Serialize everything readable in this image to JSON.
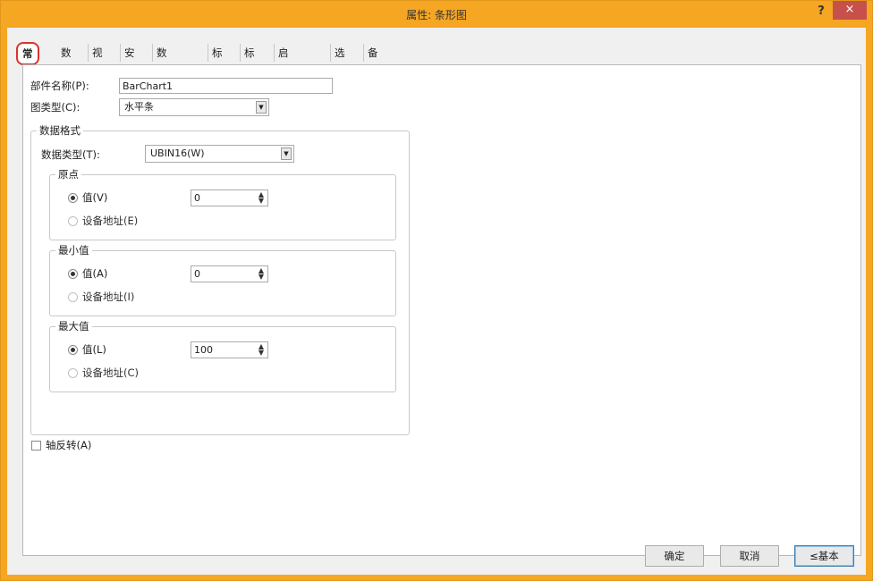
{
  "window": {
    "title": "属性: 条形图",
    "help_label": "?",
    "close_label": "×"
  },
  "tabs": [
    {
      "label": "常规",
      "active": true
    },
    {
      "label": "数据"
    },
    {
      "label": "视图"
    },
    {
      "label": "安全"
    },
    {
      "label": "数据溢出"
    },
    {
      "label": "标尺"
    },
    {
      "label": "标签"
    },
    {
      "label": "启动条件"
    },
    {
      "label": "选项"
    },
    {
      "label": "备注"
    }
  ],
  "general": {
    "part_name_label": "部件名称(P):",
    "part_name_value": "BarChart1",
    "chart_type_label": "图类型(C):",
    "chart_type_value": "水平条",
    "data_format": {
      "title": "数据格式",
      "data_type_label": "数据类型(T):",
      "data_type_value": "UBIN16(W)",
      "origin": {
        "title": "原点",
        "value_option": "值(V)",
        "value": "0",
        "device_option": "设备地址(E)"
      },
      "min": {
        "title": "最小值",
        "value_option": "值(A)",
        "value": "0",
        "device_option": "设备地址(I)"
      },
      "max": {
        "title": "最大值",
        "value_option": "值(L)",
        "value": "100",
        "device_option": "设备地址(C)"
      }
    },
    "axis_reverse_label": "轴反转(A)"
  },
  "buttons": {
    "ok": "确定",
    "cancel": "取消",
    "basic": "≤基本"
  }
}
